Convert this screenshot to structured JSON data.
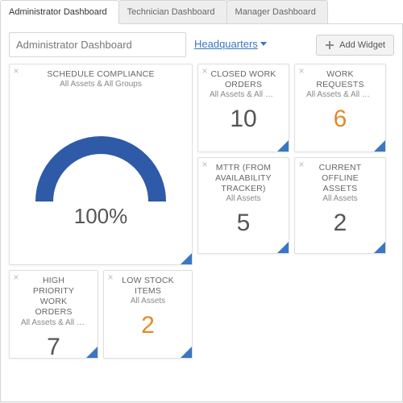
{
  "tabs": [
    {
      "label": "Administrator Dashboard",
      "active": true
    },
    {
      "label": "Technician Dashboard",
      "active": false
    },
    {
      "label": "Manager Dashboard",
      "active": false
    }
  ],
  "toolbar": {
    "title_value": "Administrator Dashboard",
    "location_label": "Headquarters",
    "add_widget_label": "Add Widget"
  },
  "widgets": {
    "schedule_compliance": {
      "title": "SCHEDULE COMPLIANCE",
      "subtitle": "All Assets & All Groups",
      "value": "100%",
      "gauge_color": "#2f5aa8"
    },
    "high_priority": {
      "title": "HIGH PRIORITY WORK ORDERS",
      "subtitle": "All Assets & All Gro...",
      "value": "7",
      "value_color": "normal"
    },
    "low_stock": {
      "title": "LOW STOCK ITEMS",
      "subtitle": "All Assets",
      "value": "2",
      "value_color": "orange"
    },
    "closed_wo": {
      "title": "CLOSED WORK ORDERS",
      "subtitle": "All Assets & All Gro...",
      "value": "10",
      "value_color": "normal"
    },
    "mttr": {
      "title": "MTTR (FROM AVAILABILITY TRACKER)",
      "subtitle": "All Assets",
      "value": "5",
      "value_color": "normal"
    },
    "work_requests": {
      "title": "WORK REQUESTS",
      "subtitle": "All Assets & All Gro...",
      "value": "6",
      "value_color": "orange"
    },
    "offline_assets": {
      "title": "CURRENT OFFLINE ASSETS",
      "subtitle": "All Assets",
      "value": "2",
      "value_color": "normal"
    }
  }
}
